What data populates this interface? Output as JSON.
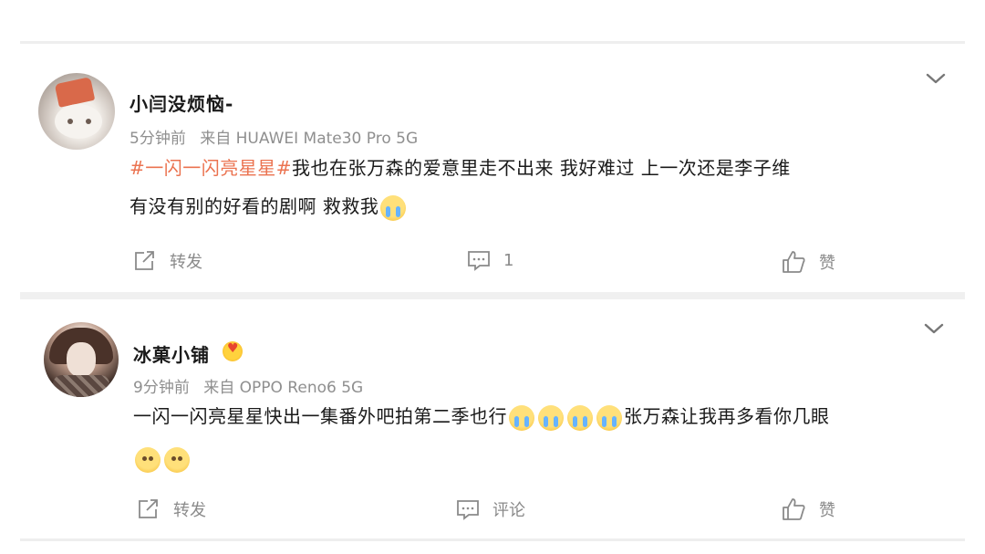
{
  "posts": [
    {
      "user": "小闫没烦恼-",
      "time": "5分钟前",
      "source": "来自 HUAWEI Mate30 Pro 5G",
      "topic": "#一闪一闪亮星星#",
      "line1": "我也在张万森的爱意里走不出来 我好难过 上一次还是李子维",
      "line2": "有没有别的好看的剧啊 救救我",
      "line2_emoji": "cry-emoji",
      "repost_label": "转发",
      "comment_label": "1",
      "like_label": "赞"
    },
    {
      "user": "冰菓小铺",
      "time": "9分钟前",
      "source": "来自 OPPO Reno6 5G",
      "line1_text": "一闪一闪亮星星快出一集番外吧拍第二季也行",
      "line1_tail": "张万森让我再多看你几眼",
      "repost_label": "转发",
      "comment_label": "评论",
      "like_label": "赞"
    }
  ],
  "colors": {
    "topic": "#eb7350",
    "meta": "#8f8f8f",
    "action": "#8a8a8a"
  }
}
